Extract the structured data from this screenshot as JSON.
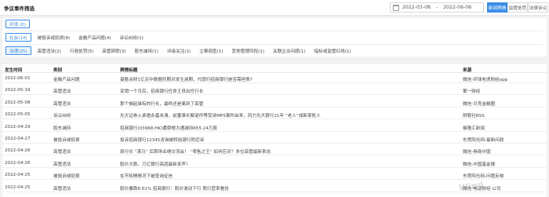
{
  "header": {
    "title": "争议事件筛选",
    "date_start": "2022-03-08",
    "date_end": "2022-06-06",
    "buttons": [
      "新闻舆情",
      "监管处罚",
      "法律诉讼"
    ]
  },
  "filters": {
    "env": {
      "chip": "环境 (0)"
    },
    "social": {
      "chip": "社会(14)",
      "items": [
        "被投诉或贬损(9)",
        "金融产品问题(4)",
        "诉讼纠纷(1)"
      ]
    },
    "governance": {
      "chip": "治理(25)",
      "items": [
        "高管违法(2)",
        "行政处罚(5)",
        "高管辞职(3)",
        "股东减持(1)",
        "评级关注(1)",
        "立案调查(1)",
        "其他管理风险(1)",
        "关联企业问题(1)",
        "指标或监管红线(1)"
      ]
    }
  },
  "table": {
    "columns": [
      "发生时间",
      "类别",
      "舆情标题",
      "来源"
    ],
    "rows": [
      {
        "date": "2022-06-01",
        "category": "金融产品问题",
        "title": "姿胜余财1亿买中数据托期对发生逾期，代销行招商银行是否需担责?",
        "source": "微信-环球老虎财经app"
      },
      {
        "date": "2022-05-19",
        "category": "高管违法",
        "title": "变销一个月后，招商银行任命王良出任行长",
        "source": "第一财经"
      },
      {
        "date": "2022-05-08",
        "category": "高管违法",
        "title": "那个做起谁有的行长，最终还是离到了高管",
        "source": "微信-贝壳金融圈"
      },
      {
        "date": "2022-05-05",
        "category": "诉讼纠纷",
        "title": "光大证券入承邀永基未清，前董事长解诺件等受讲MPS事件由来，风力光大银行21年 “老人”成新掌舵人",
        "source": "财联社RSS"
      },
      {
        "date": "2022-04-29",
        "category": "股东减持",
        "title": "招商银行(03968.HK)遭摩根大通减持655.24万股",
        "source": "格隆汇新闻"
      },
      {
        "date": "2022-04-27",
        "category": "被投诉或贬损",
        "title": "投诉招商银行12345咨询被转给银行附近诉",
        "source": "东莞阳光网-最新问政"
      },
      {
        "date": "2022-04-26",
        "category": "高管违法",
        "title": "原行长 “落马” 后首场业绩交流会！ “零售之王” 如何应对？多位高管最新表态",
        "source": "微信-券商中国"
      },
      {
        "date": "2022-04-26",
        "category": "高管违法",
        "title": "股价大跌，万亿银行高层最新发声！",
        "source": "微信-中国基金报"
      },
      {
        "date": "2022-04-25",
        "category": "被投诉或贬损",
        "title": "在不知情情况下被查询征信",
        "source": "东莞阳光网-问题反映"
      },
      {
        "date": "2022-04-25",
        "category": "高管违法",
        "title": "股价暴跌8.61% 招商银行：股价波动下行 我行营率看告",
        "source": "微信-电话财经·公司"
      }
    ]
  },
  "watermark": "Wind"
}
